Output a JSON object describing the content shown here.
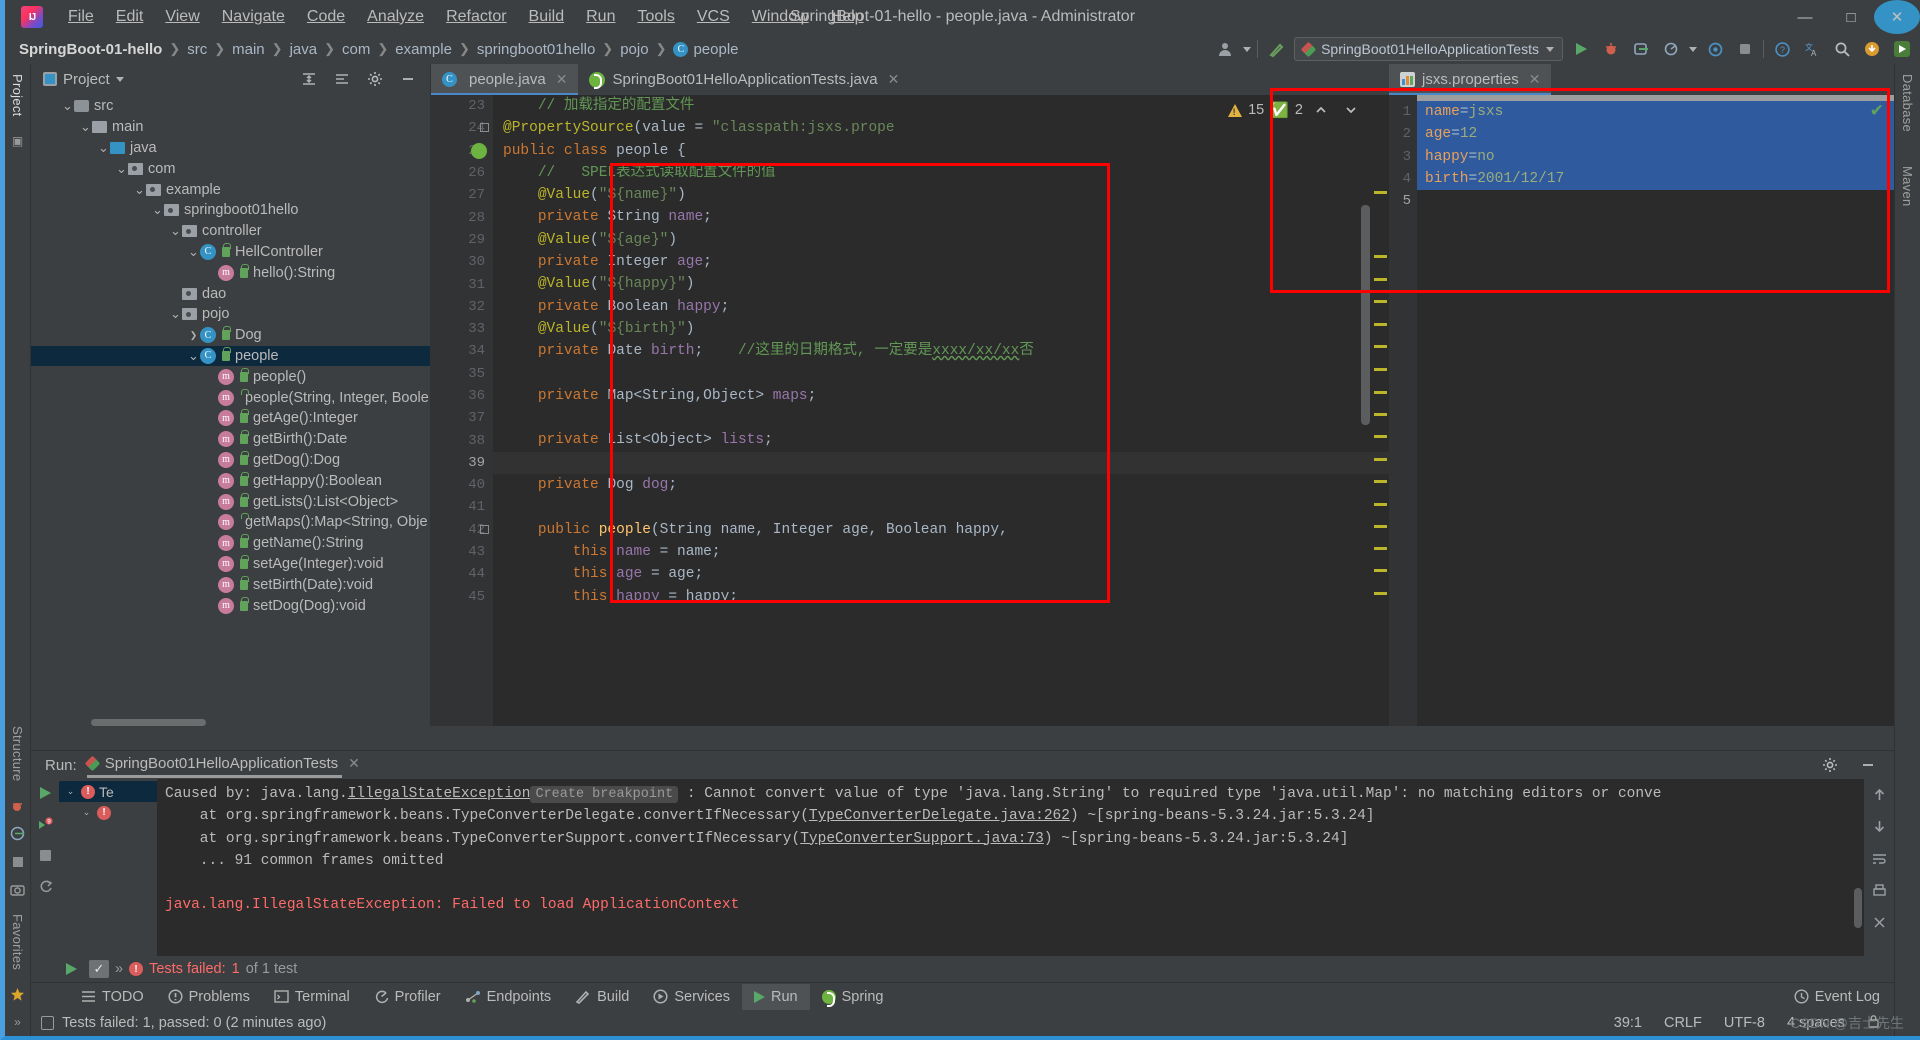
{
  "window": {
    "title": "SpringBoot-01-hello - people.java - Administrator",
    "minimize": "—",
    "maximize": "□",
    "close": "✕"
  },
  "menu": [
    {
      "label": "File"
    },
    {
      "label": "Edit"
    },
    {
      "label": "View"
    },
    {
      "label": "Navigate"
    },
    {
      "label": "Code"
    },
    {
      "label": "Analyze"
    },
    {
      "label": "Refactor"
    },
    {
      "label": "Build"
    },
    {
      "label": "Run"
    },
    {
      "label": "Tools"
    },
    {
      "label": "VCS"
    },
    {
      "label": "Window"
    },
    {
      "label": "Help"
    }
  ],
  "breadcrumb": [
    {
      "label": "SpringBoot-01-hello",
      "strong": true
    },
    {
      "label": "src"
    },
    {
      "label": "main"
    },
    {
      "label": "java"
    },
    {
      "label": "com"
    },
    {
      "label": "example"
    },
    {
      "label": "springboot01hello"
    },
    {
      "label": "pojo"
    },
    {
      "label": "people",
      "icon": "class-icon"
    }
  ],
  "toolbar": {
    "run_config": "SpringBoot01HelloApplicationTests",
    "run_config_dropdown": "▾",
    "run_button": "run-icon",
    "debug_button": "debug-icon",
    "coverage_button": "coverage-icon",
    "profile_button": "profile-icon",
    "stop_button": "stop-icon",
    "help_button": "?",
    "translate_button": "translate-icon",
    "search_button": "search-icon",
    "updates_button": "update-icon",
    "plugin_run_button": "plugin-run-icon"
  },
  "left_strip": {
    "project_label": "Project",
    "structure_label": "Structure",
    "favorites_label": "Favorites"
  },
  "right_strip": {
    "database_label": "Database",
    "maven_label": "Maven"
  },
  "project_panel": {
    "title": "Project",
    "tree": [
      {
        "indent": 1,
        "arrow": "v",
        "icon": "source-folder-icon",
        "label": "src"
      },
      {
        "indent": 2,
        "arrow": "v",
        "icon": "folder-icon",
        "label": "main"
      },
      {
        "indent": 3,
        "arrow": "v",
        "icon": "folder-blue-icon",
        "label": "java"
      },
      {
        "indent": 4,
        "arrow": "v",
        "icon": "package-icon",
        "label": "com"
      },
      {
        "indent": 5,
        "arrow": "v",
        "icon": "package-icon",
        "label": "example"
      },
      {
        "indent": 6,
        "arrow": "v",
        "icon": "package-icon",
        "label": "springboot01hello"
      },
      {
        "indent": 7,
        "arrow": "v",
        "icon": "package-icon",
        "label": "controller"
      },
      {
        "indent": 8,
        "arrow": "v",
        "icon": "class-icon",
        "lock": true,
        "label": "HellController"
      },
      {
        "indent": 9,
        "arrow": "",
        "icon": "method-icon",
        "lock": true,
        "label": "hello():String"
      },
      {
        "indent": 7,
        "arrow": "",
        "icon": "package-icon",
        "label": "dao"
      },
      {
        "indent": 7,
        "arrow": "v",
        "icon": "package-icon",
        "label": "pojo"
      },
      {
        "indent": 8,
        "arrow": ">",
        "icon": "class-icon",
        "lock": true,
        "label": "Dog"
      },
      {
        "indent": 8,
        "arrow": "v",
        "icon": "class-icon",
        "lock": true,
        "label": "people",
        "selected": true
      },
      {
        "indent": 9,
        "arrow": "",
        "icon": "method-icon",
        "lock": true,
        "label": "people()"
      },
      {
        "indent": 9,
        "arrow": "",
        "icon": "method-icon",
        "lock": true,
        "label": "people(String, Integer, Boole"
      },
      {
        "indent": 9,
        "arrow": "",
        "icon": "method-icon",
        "lock": true,
        "label": "getAge():Integer"
      },
      {
        "indent": 9,
        "arrow": "",
        "icon": "method-icon",
        "lock": true,
        "label": "getBirth():Date"
      },
      {
        "indent": 9,
        "arrow": "",
        "icon": "method-icon",
        "lock": true,
        "label": "getDog():Dog"
      },
      {
        "indent": 9,
        "arrow": "",
        "icon": "method-icon",
        "lock": true,
        "label": "getHappy():Boolean"
      },
      {
        "indent": 9,
        "arrow": "",
        "icon": "method-icon",
        "lock": true,
        "label": "getLists():List<Object>"
      },
      {
        "indent": 9,
        "arrow": "",
        "icon": "method-icon",
        "lock": true,
        "label": "getMaps():Map<String, Obje"
      },
      {
        "indent": 9,
        "arrow": "",
        "icon": "method-icon",
        "lock": true,
        "label": "getName():String"
      },
      {
        "indent": 9,
        "arrow": "",
        "icon": "method-icon",
        "lock": true,
        "label": "setAge(Integer):void"
      },
      {
        "indent": 9,
        "arrow": "",
        "icon": "method-icon",
        "lock": true,
        "label": "setBirth(Date):void"
      },
      {
        "indent": 9,
        "arrow": "",
        "icon": "method-icon",
        "lock": true,
        "label": "setDog(Dog):void"
      }
    ]
  },
  "editor": {
    "tabs": [
      {
        "label": "people.java",
        "icon": "class-icon",
        "active": true,
        "close": "✕"
      },
      {
        "label": "SpringBoot01HelloApplicationTests.java",
        "icon": "spring-icon",
        "active": false,
        "close": "✕"
      }
    ],
    "inspection": {
      "warnings": "15",
      "weak_warnings": "2",
      "up": "^",
      "down": "v"
    },
    "first_line_number": 23,
    "current_line": 39,
    "lines": [
      {
        "n": 23,
        "text": "    // 加载指定的配置文件",
        "type": "comment"
      },
      {
        "n": 24,
        "text": "@PropertySource(value = \"classpath:jsxs.prope",
        "type": "annotation_line"
      },
      {
        "n": 25,
        "text": "public class people {",
        "type": "class_decl"
      },
      {
        "n": 26,
        "text": "    //   SPEL表达式读取配置文件的值",
        "type": "comment"
      },
      {
        "n": 27,
        "text": "    @Value(\"${name}\")",
        "type": "annotation"
      },
      {
        "n": 28,
        "text": "    private String name;",
        "type": "field"
      },
      {
        "n": 29,
        "text": "    @Value(\"${age}\")",
        "type": "annotation"
      },
      {
        "n": 30,
        "text": "    private Integer age;",
        "type": "field"
      },
      {
        "n": 31,
        "text": "    @Value(\"${happy}\")",
        "type": "annotation"
      },
      {
        "n": 32,
        "text": "    private Boolean happy;",
        "type": "field"
      },
      {
        "n": 33,
        "text": "    @Value(\"${birth}\")",
        "type": "annotation"
      },
      {
        "n": 34,
        "text": "    private Date birth;    //这里的日期格式, 一定要是xxxx/xx/xx否",
        "type": "field_comment"
      },
      {
        "n": 35,
        "text": "",
        "type": "blank"
      },
      {
        "n": 36,
        "text": "    private Map<String,Object> maps;",
        "type": "field"
      },
      {
        "n": 37,
        "text": "",
        "type": "blank"
      },
      {
        "n": 38,
        "text": "    private List<Object> lists;",
        "type": "field"
      },
      {
        "n": 39,
        "text": "",
        "type": "blank_current"
      },
      {
        "n": 40,
        "text": "    private Dog dog;",
        "type": "field"
      },
      {
        "n": 41,
        "text": "",
        "type": "blank"
      },
      {
        "n": 42,
        "text": "    public people(String name, Integer age, Boolean happy,",
        "type": "ctor"
      },
      {
        "n": 43,
        "text": "        this.name = name;",
        "type": "assign"
      },
      {
        "n": 44,
        "text": "        this.age = age;",
        "type": "assign"
      },
      {
        "n": 45,
        "text": "        this.happy = happy;",
        "type": "assign"
      }
    ]
  },
  "properties_editor": {
    "tab": {
      "label": "jsxs.properties",
      "icon": "properties-icon",
      "close": "✕"
    },
    "ok_badge": "✔",
    "lines": [
      {
        "n": 1,
        "key": "name",
        "sep": "=",
        "value": "jsxs",
        "highlighted": true
      },
      {
        "n": 2,
        "key": "age",
        "sep": "=",
        "value": "12",
        "highlighted": true
      },
      {
        "n": 3,
        "key": "happy",
        "sep": "=",
        "value": "no",
        "highlighted": true
      },
      {
        "n": 4,
        "key": "birth",
        "sep": "=",
        "value": "2001/12/17",
        "highlighted": true
      },
      {
        "n": 5,
        "key": "",
        "sep": "",
        "value": "",
        "highlighted": false
      }
    ]
  },
  "run_panel": {
    "label": "Run:",
    "tab": "SpringBoot01HelloApplicationTests",
    "tab_close": "✕",
    "test_status_prefix": "Tests failed:",
    "test_status_count": "1",
    "test_status_suffix": "of 1 test",
    "test_tree": [
      {
        "indent": 0,
        "arrow": "v",
        "label": "Te"
      },
      {
        "indent": 1,
        "arrow": "v",
        "label": ""
      }
    ],
    "console": [
      {
        "type": "caused_by",
        "prefix": "Caused by: java.lang.",
        "exception": "IllegalStateException",
        "breakpoint": "Create breakpoint",
        "rest": " : Cannot convert value of type 'java.lang.String' to required type 'java.util.Map': no matching editors or conve"
      },
      {
        "type": "at",
        "prefix": "    at org.springframework.beans.TypeConverterDelegate.convertIfNecessary(",
        "link": "TypeConverterDelegate.java:262",
        "rest": ") ~[spring-beans-5.3.24.jar:5.3.24]"
      },
      {
        "type": "at",
        "prefix": "    at org.springframework.beans.TypeConverterSupport.convertIfNecessary(",
        "link": "TypeConverterSupport.java:73",
        "rest": ") ~[spring-beans-5.3.24.jar:5.3.24]"
      },
      {
        "type": "plain",
        "text": "    ... 91 common frames omitted"
      },
      {
        "type": "blank",
        "text": ""
      },
      {
        "type": "error",
        "text": "java.lang.IllegalStateException: Failed to load ApplicationContext"
      }
    ]
  },
  "bottom_bar": {
    "items": [
      {
        "label": "TODO",
        "icon": "todo-icon"
      },
      {
        "label": "Problems",
        "icon": "problems-icon"
      },
      {
        "label": "Terminal",
        "icon": "terminal-icon"
      },
      {
        "label": "Profiler",
        "icon": "profiler-icon"
      },
      {
        "label": "Endpoints",
        "icon": "endpoints-icon"
      },
      {
        "label": "Build",
        "icon": "build-icon"
      },
      {
        "label": "Services",
        "icon": "services-icon"
      },
      {
        "label": "Run",
        "icon": "run-icon",
        "active": true
      },
      {
        "label": "Spring",
        "icon": "spring-icon"
      }
    ],
    "event_log": "Event Log"
  },
  "status_bar": {
    "message": "Tests failed: 1, passed: 0 (2 minutes ago)",
    "caret": "39:1",
    "line_sep": "CRLF",
    "encoding": "UTF-8",
    "indent": "4 spaces",
    "watermark": "CSDN @吉士先生"
  },
  "colors": {
    "accent": "#4a88c7",
    "annotation_red": "#ff0000",
    "selection_blue": "#2f5b9e",
    "error_red": "#ff6b68",
    "string_green": "#6a8759",
    "keyword_orange": "#cc7832",
    "tree_selection": "#0d293e"
  }
}
